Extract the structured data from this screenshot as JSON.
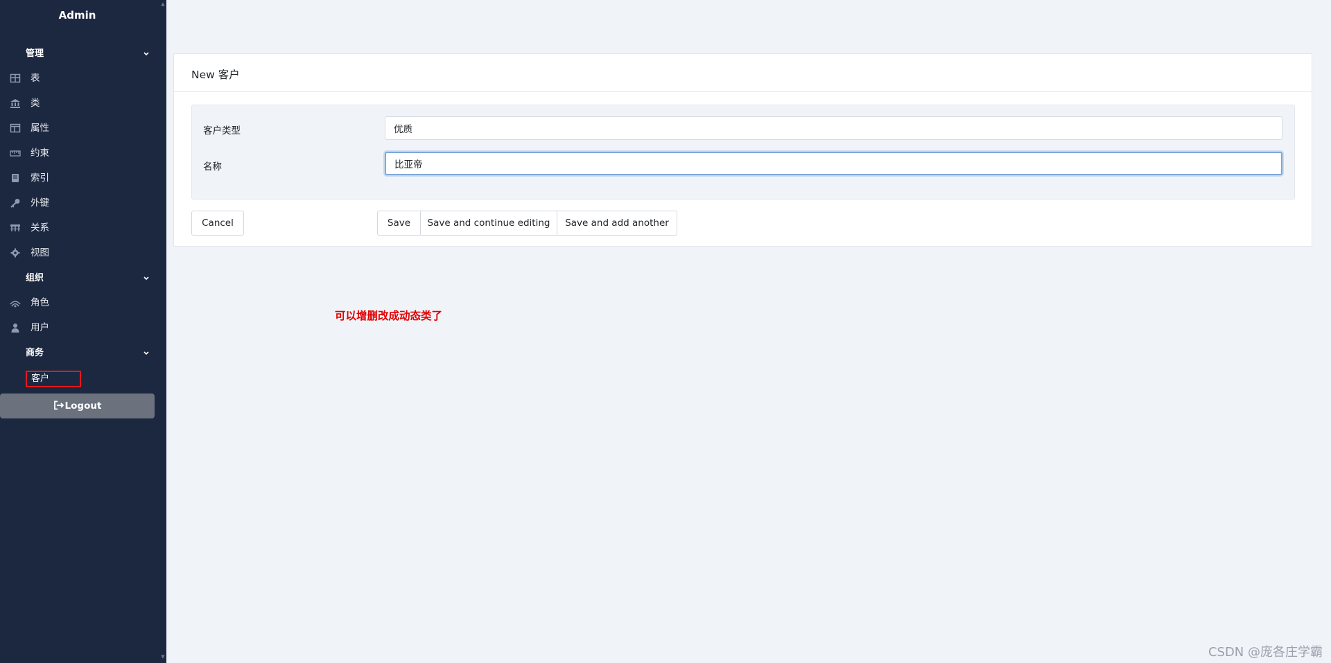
{
  "sidebar": {
    "title": "Admin",
    "sections": [
      {
        "label": "管理"
      },
      {
        "label": "组织"
      },
      {
        "label": "商务"
      }
    ],
    "items": [
      {
        "label": "表",
        "icon": "table-icon"
      },
      {
        "label": "类",
        "icon": "bank-icon"
      },
      {
        "label": "属性",
        "icon": "columns-icon"
      },
      {
        "label": "约束",
        "icon": "ruler-icon"
      },
      {
        "label": "索引",
        "icon": "book-icon"
      },
      {
        "label": "外键",
        "icon": "key-icon"
      },
      {
        "label": "关系",
        "icon": "relation-icon"
      },
      {
        "label": "视图",
        "icon": "gear-icon"
      },
      {
        "label": "角色",
        "icon": "role-icon"
      },
      {
        "label": "用户",
        "icon": "user-icon"
      }
    ],
    "active_item": "客户",
    "logout_label": "Logout"
  },
  "main": {
    "title": "New 客户",
    "fields": [
      {
        "label": "客户类型",
        "value": "优质"
      },
      {
        "label": "名称",
        "value": "比亚帝"
      }
    ],
    "buttons": {
      "cancel": "Cancel",
      "save": "Save",
      "save_continue": "Save and continue editing",
      "save_add": "Save and add another"
    }
  },
  "annotation": "可以增删改成动态类了",
  "watermark": "CSDN @庞各庄学霸",
  "colors": {
    "sidebar_bg": "#1c2840",
    "page_bg": "#f0f3f8",
    "highlight_box": "#e3181e",
    "annotation_text": "#e10000",
    "logout_bg": "#6b727e"
  }
}
